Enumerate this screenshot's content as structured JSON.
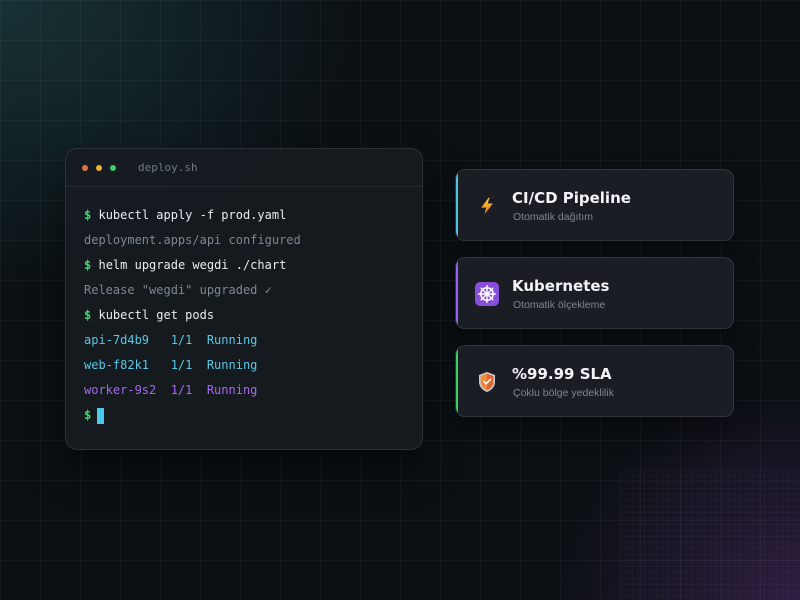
{
  "terminal": {
    "title": "deploy.sh",
    "lines": [
      {
        "type": "command",
        "prompt": "$",
        "text": "kubectl apply -f prod.yaml"
      },
      {
        "type": "output",
        "text": "deployment.apps/api configured"
      },
      {
        "type": "command",
        "prompt": "$",
        "text": "helm upgrade wegdi ./chart"
      },
      {
        "type": "output",
        "text": "Release \"wegdi\" upgraded ✓"
      },
      {
        "type": "command",
        "prompt": "$",
        "text": "kubectl get pods"
      },
      {
        "type": "pod",
        "text": "api-7d4b9   1/1  Running",
        "color": "#59c7e6"
      },
      {
        "type": "pod",
        "text": "web-f82k1   1/1  Running",
        "color": "#59c7e6"
      },
      {
        "type": "pod",
        "text": "worker-9s2  1/1  Running",
        "color": "#a568f0"
      }
    ],
    "current_prompt": "$"
  },
  "cards": [
    {
      "title": "CI/CD Pipeline",
      "subtitle": "Otomatik dağıtım",
      "icon": "lightning-icon",
      "accent": "#4ec4e2"
    },
    {
      "title": "Kubernetes",
      "subtitle": "Otomatik ölçekleme",
      "icon": "kubernetes-helm-icon",
      "accent": "#9b63f2"
    },
    {
      "title": "%99.99 SLA",
      "subtitle": "Çoklu bölge yedeklilik",
      "icon": "shield-icon",
      "accent": "#3fcf5e"
    }
  ]
}
